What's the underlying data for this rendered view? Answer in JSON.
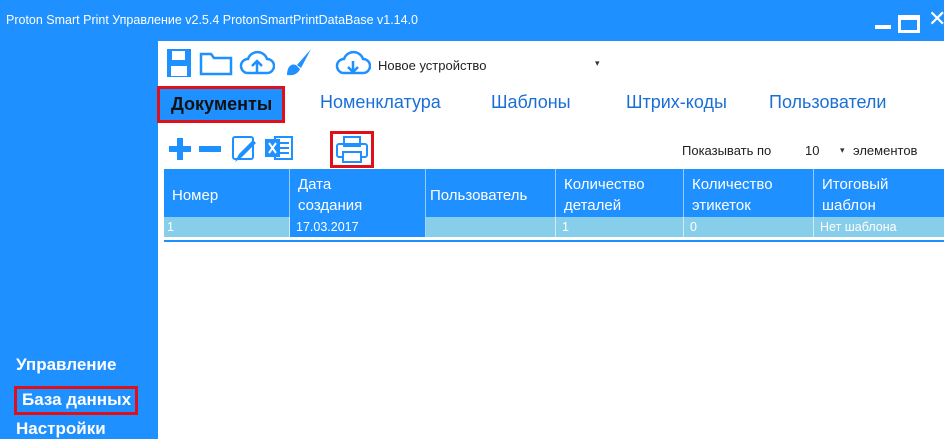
{
  "window": {
    "title": "Proton Smart Print Управление v2.5.4 ProtonSmartPrintDataBase v1.14.0",
    "minimize_icon": "minimize-icon",
    "maximize_icon": "maximize-icon",
    "close_label": "✕"
  },
  "colors": {
    "accent": "#1e90ff",
    "row": "#87ceeb",
    "highlight": "#e0101a"
  },
  "toolbar": {
    "icons": [
      "save-icon",
      "folder-open-icon",
      "cloud-upload-icon",
      "brush-icon",
      "cloud-download-icon"
    ],
    "device_label": "Новое устройство",
    "device_arrow": "▾"
  },
  "tabs": [
    {
      "label": "Документы"
    },
    {
      "label": "Номенклатура"
    },
    {
      "label": "Шаблоны"
    },
    {
      "label": "Штрих-коды"
    },
    {
      "label": "Пользователи"
    }
  ],
  "actions": {
    "icons": [
      "add-icon",
      "remove-icon",
      "edit-icon",
      "excel-icon",
      "print-icon"
    ],
    "show_label": "Показывать по",
    "show_count": "10",
    "show_arrow": "▾",
    "show_unit": "элементов"
  },
  "table": {
    "headers": [
      {
        "l1": "Номер",
        "l2": ""
      },
      {
        "l1": "Дата",
        "l2": "создания"
      },
      {
        "l1": "Пользователь",
        "l2": ""
      },
      {
        "l1": "Количество",
        "l2": "деталей"
      },
      {
        "l1": "Количество",
        "l2": "этикеток"
      },
      {
        "l1": "Итоговый",
        "l2": "шаблон"
      }
    ],
    "rows": [
      [
        "1",
        "17.03.2017",
        "",
        "1",
        "0",
        "Нет шаблона"
      ]
    ]
  },
  "sidebar": {
    "items": [
      {
        "label": "Управление"
      },
      {
        "label": "База данных"
      },
      {
        "label": "Настройки"
      }
    ]
  }
}
